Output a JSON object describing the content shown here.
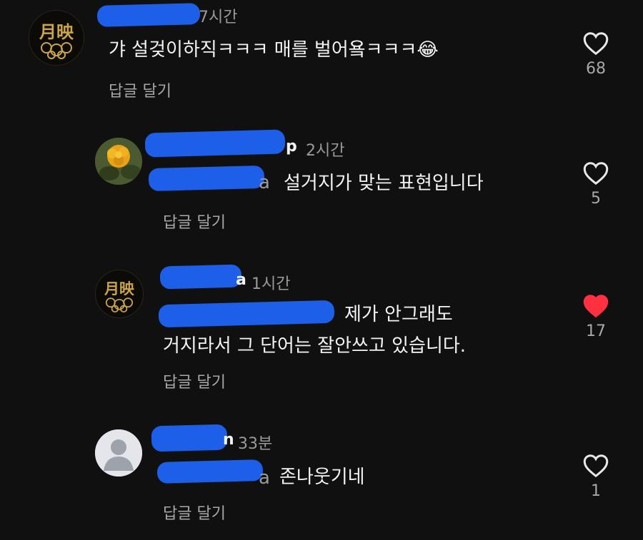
{
  "comments": [
    {
      "time": "7시간",
      "text": "갸 설겆이하직ㅋㅋㅋ 매를 벌어욬ㅋㅋㅋ😂",
      "reply_label": "답글 달기",
      "likes": "68",
      "liked": false
    },
    {
      "name_tail": "p",
      "time": "2시간",
      "mention_tail": "a",
      "text": "설거지가 맞는 표현입니다",
      "reply_label": "답글 달기",
      "likes": "5",
      "liked": false
    },
    {
      "name_tail": "a",
      "time": "1시간",
      "text_line1": "제가 안그래도",
      "text_line2": "거지라서 그 단어는 잘안쓰고 있습니다.",
      "reply_label": "답글 달기",
      "likes": "17",
      "liked": true
    },
    {
      "name_tail": "n",
      "time": "33분",
      "mention_tail": "a",
      "text": "존나웃기네",
      "reply_label": "답글 달기",
      "likes": "1",
      "liked": false
    }
  ],
  "colors": {
    "background": "#101010",
    "redaction": "#1d5fe8",
    "liked_heart": "#ff3040",
    "mention": "#3b82f6"
  },
  "icons": {
    "like": "heart-outline-icon",
    "liked": "heart-filled-icon"
  },
  "avatar_seal_text": "月映"
}
